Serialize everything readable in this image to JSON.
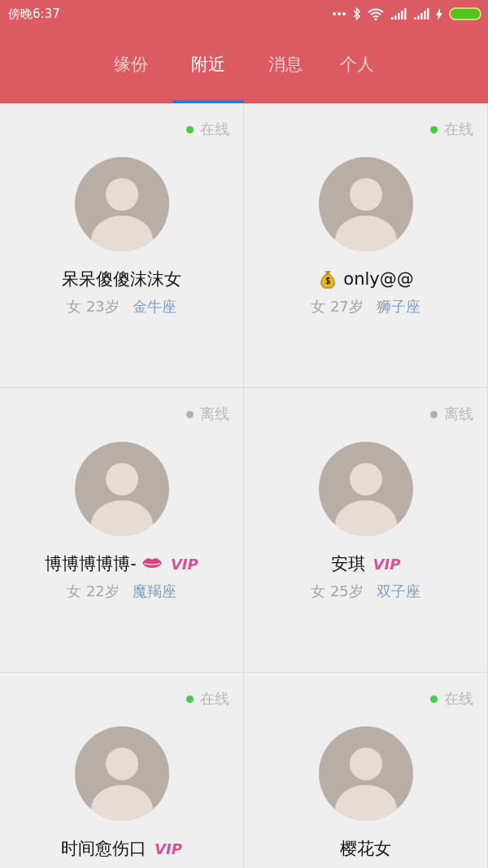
{
  "status_bar": {
    "time": "傍晚6:37"
  },
  "tabs": [
    {
      "label": "缘份",
      "selected": false
    },
    {
      "label": "附近",
      "selected": true
    },
    {
      "label": "消息",
      "selected": false
    },
    {
      "label": "个人",
      "selected": false
    }
  ],
  "users": [
    {
      "online": true,
      "status": "在线",
      "name": "呆呆傻傻沫沫女",
      "kind": "plain",
      "vip": false,
      "gender": "女",
      "age": "23岁",
      "sign": "金牛座"
    },
    {
      "online": true,
      "status": "在线",
      "name": "only@@",
      "kind": "moneybag",
      "vip": false,
      "gender": "女",
      "age": "27岁",
      "sign": "狮子座"
    },
    {
      "online": false,
      "status": "离线",
      "name": "博博博博博-",
      "kind": "kiss",
      "vip": true,
      "vip_label": "VIP",
      "gender": "女",
      "age": "22岁",
      "sign": "魔羯座"
    },
    {
      "online": false,
      "status": "离线",
      "name": "安琪",
      "kind": "plain",
      "vip": true,
      "vip_label": "VIP",
      "gender": "女",
      "age": "25岁",
      "sign": "双子座"
    },
    {
      "online": true,
      "status": "在线",
      "name": "时间愈伤口",
      "kind": "plain",
      "vip": true,
      "vip_label": "VIP"
    },
    {
      "online": true,
      "status": "在线",
      "name": "樱花女",
      "kind": "plain",
      "vip": false
    }
  ]
}
